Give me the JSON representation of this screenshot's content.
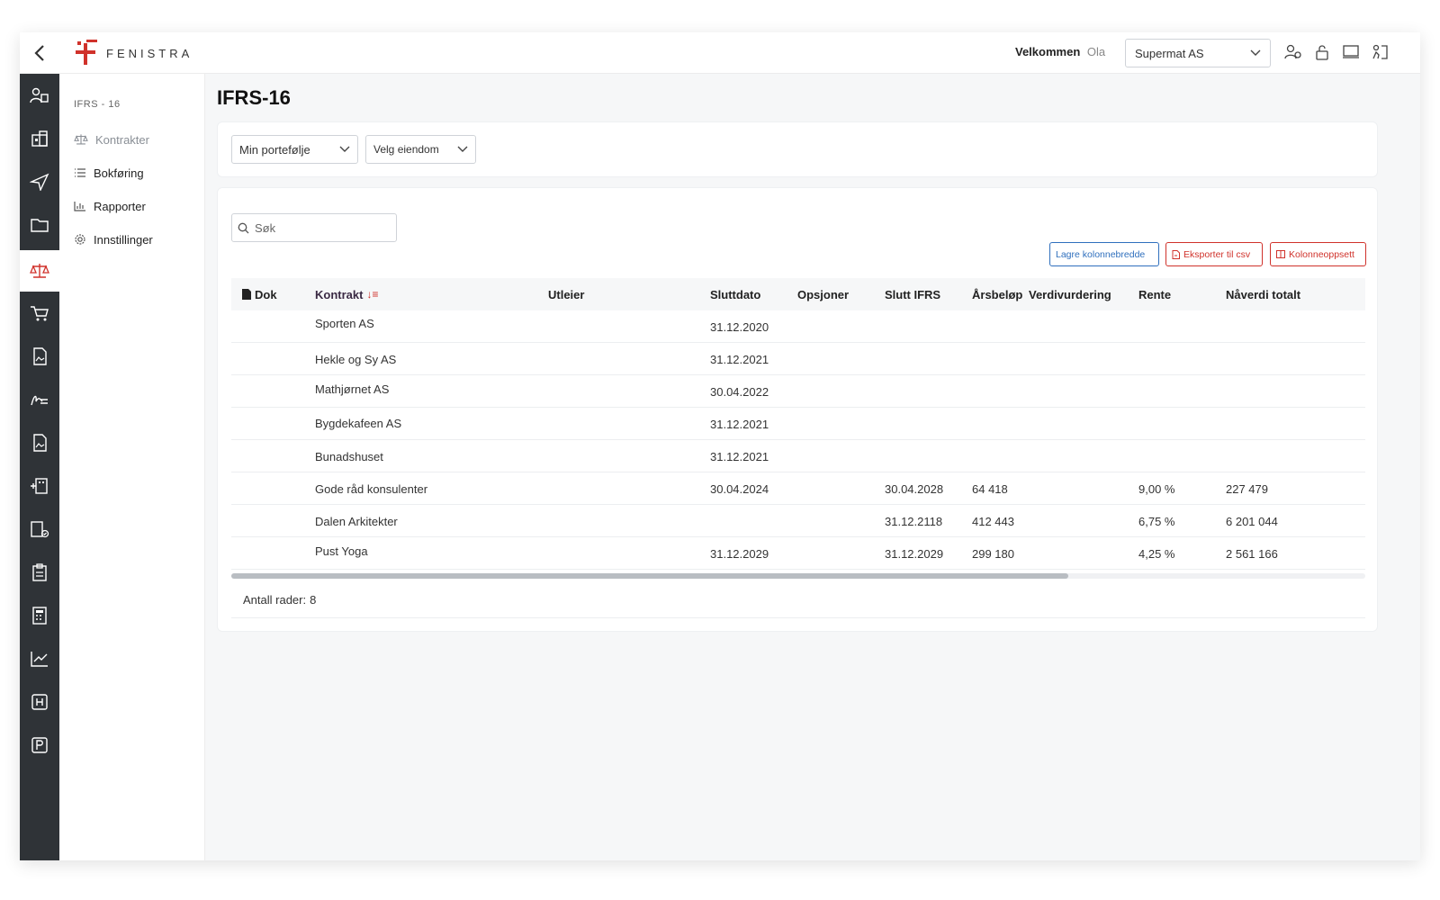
{
  "header": {
    "logo_text": "FENISTRA",
    "welcome_label": "Velkommen",
    "user_name": "Ola",
    "company_select": "Supermat AS",
    "brand_color": "#d0322b"
  },
  "subnav": {
    "section_title": "IFRS - 16",
    "items": [
      {
        "label": "Kontrakter",
        "icon": "scales-icon",
        "active": true
      },
      {
        "label": "Bokføring",
        "icon": "list-icon"
      },
      {
        "label": "Rapporter",
        "icon": "bar-chart-icon"
      },
      {
        "label": "Innstillinger",
        "icon": "gear-icon"
      }
    ]
  },
  "rail_icons": [
    "users-icon",
    "building-icon",
    "send-icon",
    "folder-icon",
    "scales-icon",
    "cart-icon",
    "image-doc-icon",
    "signature-icon",
    "image-doc-icon",
    "building-plus-icon",
    "building-check-icon",
    "clipboard-icon",
    "calculator-icon",
    "trend-chart-icon",
    "h-box-icon",
    "p-box-icon"
  ],
  "main": {
    "title": "IFRS-16",
    "filters": {
      "portfolio": "Min portefølje",
      "property": "Velg eiendom"
    },
    "search_placeholder": "Søk",
    "buttons": {
      "save_width": "Lagre kolonnebredde",
      "export_csv": "Eksporter til csv",
      "columns": "Kolonneoppsett"
    },
    "columns": [
      "Dok",
      "Kontrakt",
      "Utleier",
      "Sluttdato",
      "Opsjoner",
      "Slutt IFRS",
      "Årsbeløp",
      "Verdivurdering",
      "Rente",
      "Nåverdi totalt"
    ],
    "rows": [
      {
        "kontrakt": "Sporten AS",
        "sluttdato": "31.12.2020",
        "slutt_ifrs": "",
        "arsbelop": "",
        "rente": "",
        "naverdi": ""
      },
      {
        "kontrakt": "Hekle og Sy AS",
        "sluttdato": "31.12.2021",
        "slutt_ifrs": "",
        "arsbelop": "",
        "rente": "",
        "naverdi": ""
      },
      {
        "kontrakt": "Mathjørnet AS",
        "sluttdato": "30.04.2022",
        "slutt_ifrs": "",
        "arsbelop": "",
        "rente": "",
        "naverdi": ""
      },
      {
        "kontrakt": "Bygdekafeen AS",
        "sluttdato": "31.12.2021",
        "slutt_ifrs": "",
        "arsbelop": "",
        "rente": "",
        "naverdi": ""
      },
      {
        "kontrakt": "Bunadshuset",
        "sluttdato": "31.12.2021",
        "slutt_ifrs": "",
        "arsbelop": "",
        "rente": "",
        "naverdi": ""
      },
      {
        "kontrakt": "Gode råd konsulenter",
        "sluttdato": "30.04.2024",
        "slutt_ifrs": "30.04.2028",
        "arsbelop": "64 418",
        "rente": "9,00 %",
        "naverdi": "227 479"
      },
      {
        "kontrakt": "Dalen Arkitekter",
        "sluttdato": "",
        "slutt_ifrs": "31.12.2118",
        "arsbelop": "412 443",
        "rente": "6,75 %",
        "naverdi": "6 201 044"
      },
      {
        "kontrakt": "Pust Yoga",
        "sluttdato": "31.12.2029",
        "slutt_ifrs": "31.12.2029",
        "arsbelop": "299 180",
        "rente": "4,25 %",
        "naverdi": "2 561 166"
      }
    ],
    "row_count_label": "Antall rader:",
    "row_count": "8"
  }
}
